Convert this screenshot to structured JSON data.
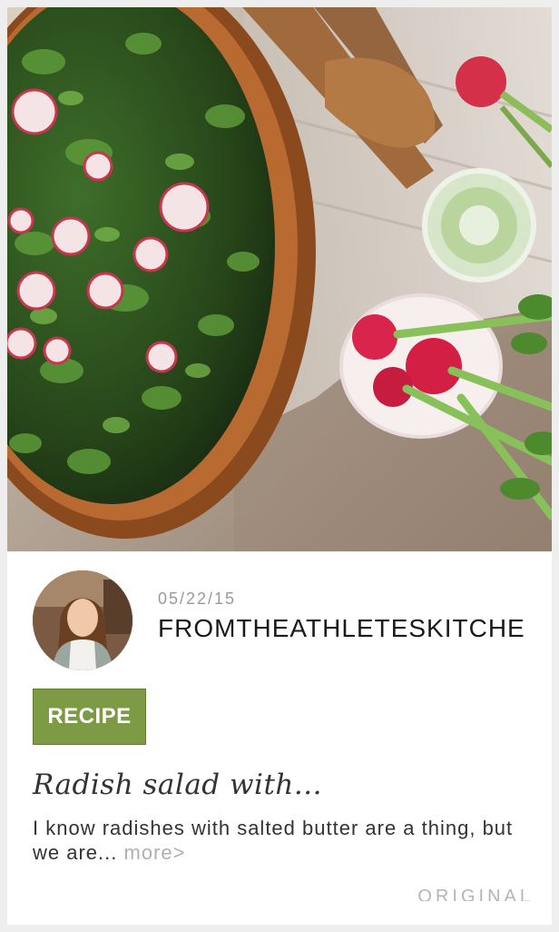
{
  "post": {
    "date": "05/22/15",
    "source_name": "FROMTHEATHLETESKITCHE",
    "badge": "RECIPE",
    "title": "Radish salad with...",
    "excerpt": "I know radishes with salted butter are a thing, but we are...",
    "more_label": "more>",
    "original_source_label": "ORIGINAL SOURCE"
  },
  "colors": {
    "badge": "#7d9a45",
    "page_background": "#eeeeee",
    "card_background": "#ffffff",
    "muted_text": "#9a9a9a"
  }
}
